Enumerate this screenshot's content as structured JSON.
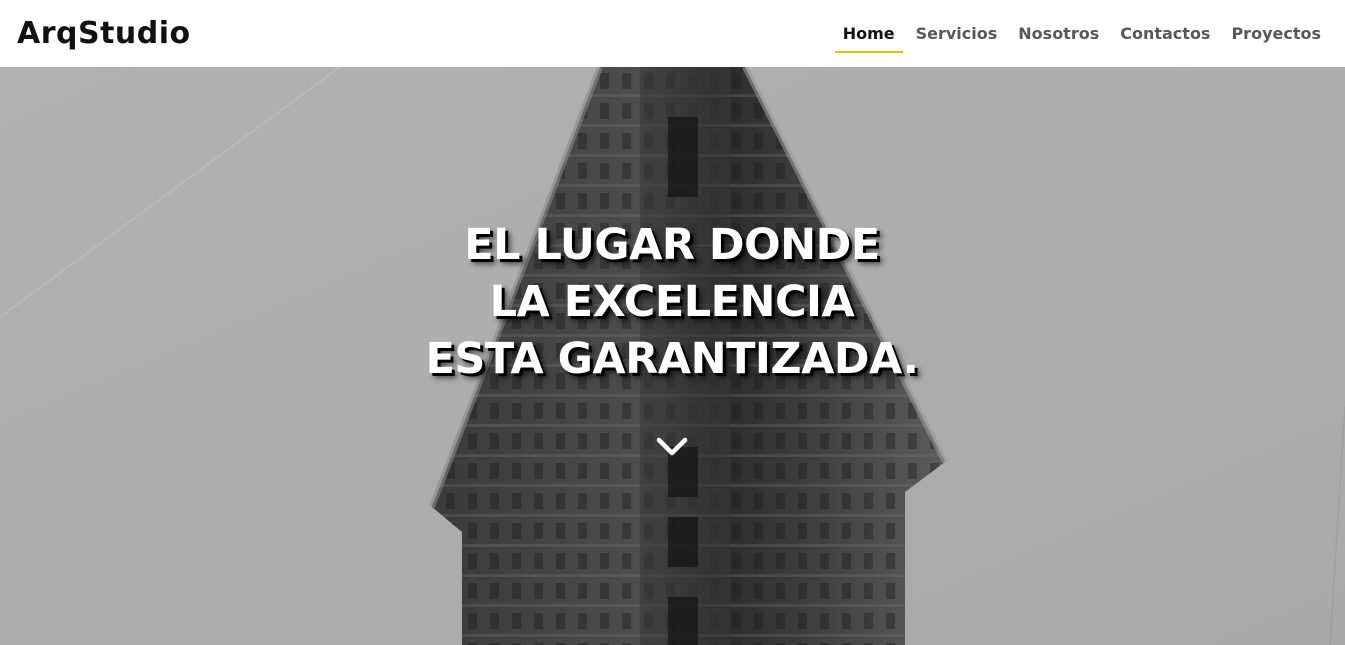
{
  "brand": {
    "name": "ArqStudio"
  },
  "nav": {
    "items": [
      {
        "label": "Home",
        "active": true
      },
      {
        "label": "Servicios",
        "active": false
      },
      {
        "label": "Nosotros",
        "active": false
      },
      {
        "label": "Contactos",
        "active": false
      },
      {
        "label": "Proyectos",
        "active": false
      }
    ],
    "active_underline_color": "#e6c200"
  },
  "hero": {
    "headline_lines": [
      "EL LUGAR DONDE",
      "LA EXCELENCIA",
      "ESTA GARANTIZADA."
    ],
    "scroll_icon": "chevron-down-icon",
    "background_image": "black-and-white-flatiron-building"
  }
}
